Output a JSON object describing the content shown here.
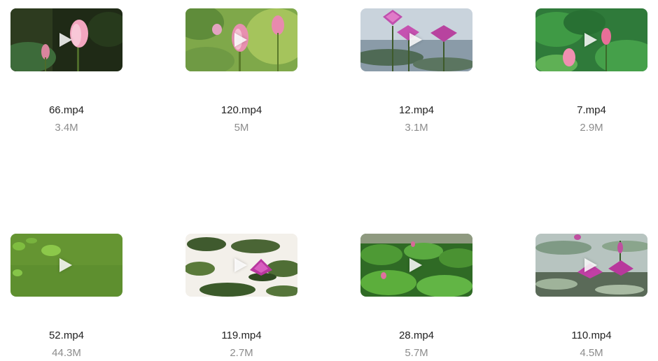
{
  "videos": [
    {
      "name": "66.mp4",
      "size": "3.4M",
      "thumb_icon": "pink-lotus-bud-thumbnail"
    },
    {
      "name": "120.mp4",
      "size": "5M",
      "thumb_icon": "pink-lotus-buds-leaves-thumbnail"
    },
    {
      "name": "12.mp4",
      "size": "3.1M",
      "thumb_icon": "purple-water-lilies-thumbnail"
    },
    {
      "name": "7.mp4",
      "size": "2.9M",
      "thumb_icon": "lotus-leaves-buds-thumbnail"
    },
    {
      "name": "52.mp4",
      "size": "44.3M",
      "thumb_icon": "green-pond-water-thumbnail"
    },
    {
      "name": "119.mp4",
      "size": "2.7M",
      "thumb_icon": "water-lily-pads-thumbnail"
    },
    {
      "name": "28.mp4",
      "size": "5.7M",
      "thumb_icon": "lotus-leaves-field-thumbnail"
    },
    {
      "name": "110.mp4",
      "size": "4.5M",
      "thumb_icon": "water-lilies-pond-thumbnail"
    }
  ]
}
